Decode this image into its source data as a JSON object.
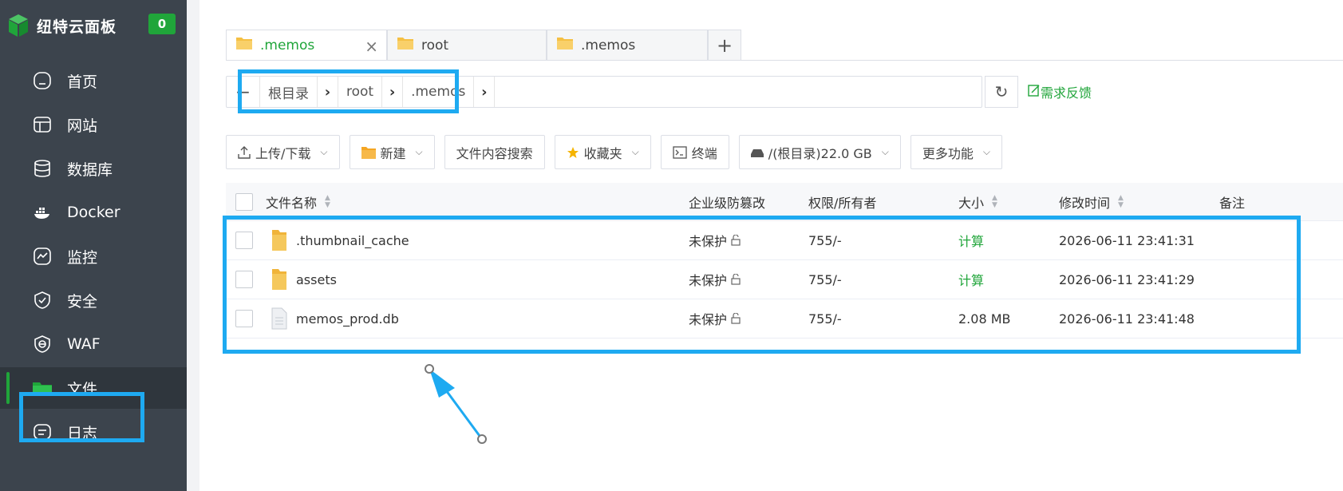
{
  "sidebar": {
    "logo_text": "纽特云面板",
    "badge": "0",
    "items": [
      {
        "label": "首页",
        "icon": "home-icon"
      },
      {
        "label": "网站",
        "icon": "website-icon"
      },
      {
        "label": "数据库",
        "icon": "database-icon"
      },
      {
        "label": "Docker",
        "icon": "docker-icon"
      },
      {
        "label": "监控",
        "icon": "monitor-icon"
      },
      {
        "label": "安全",
        "icon": "shield-icon"
      },
      {
        "label": "WAF",
        "icon": "waf-icon"
      },
      {
        "label": "文件",
        "icon": "folder-icon",
        "active": true
      },
      {
        "label": "日志",
        "icon": "log-icon"
      }
    ]
  },
  "tabs": [
    {
      "label": ".memos",
      "active": true,
      "close": "×"
    },
    {
      "label": "root"
    },
    {
      "label": ".memos"
    }
  ],
  "tab_add": "+",
  "path": {
    "back": "←",
    "crumbs": [
      "根目录",
      "root",
      ".memos"
    ],
    "sep": "›",
    "refresh": "↻",
    "feedback": "需求反馈"
  },
  "toolbar": {
    "upload": "上传/下载",
    "new": "新建",
    "search": "文件内容搜索",
    "favorites": "收藏夹",
    "terminal": "终端",
    "disk": "/(根目录)22.0 GB",
    "more": "更多功能"
  },
  "table": {
    "headers": {
      "name": "文件名称",
      "tamper": "企业级防篡改",
      "perm": "权限/所有者",
      "size": "大小",
      "mtime": "修改时间",
      "note": "备注"
    },
    "rows": [
      {
        "name": ".thumbnail_cache",
        "type": "folder",
        "tamper": "未保护",
        "perm": "755/-",
        "size": "计算",
        "mtime": "2026-06-11 23:41:31"
      },
      {
        "name": "assets",
        "type": "folder",
        "tamper": "未保护",
        "perm": "755/-",
        "size": "计算",
        "mtime": "2026-06-11 23:41:29"
      },
      {
        "name": "memos_prod.db",
        "type": "file",
        "tamper": "未保护",
        "perm": "755/-",
        "size": "2.08 MB",
        "mtime": "2026-06-11 23:41:48"
      }
    ]
  },
  "colors": {
    "accent": "#20a53a",
    "sidebar": "#3c444d",
    "highlight": "#1eaaf1",
    "folder": "#f5c044"
  }
}
